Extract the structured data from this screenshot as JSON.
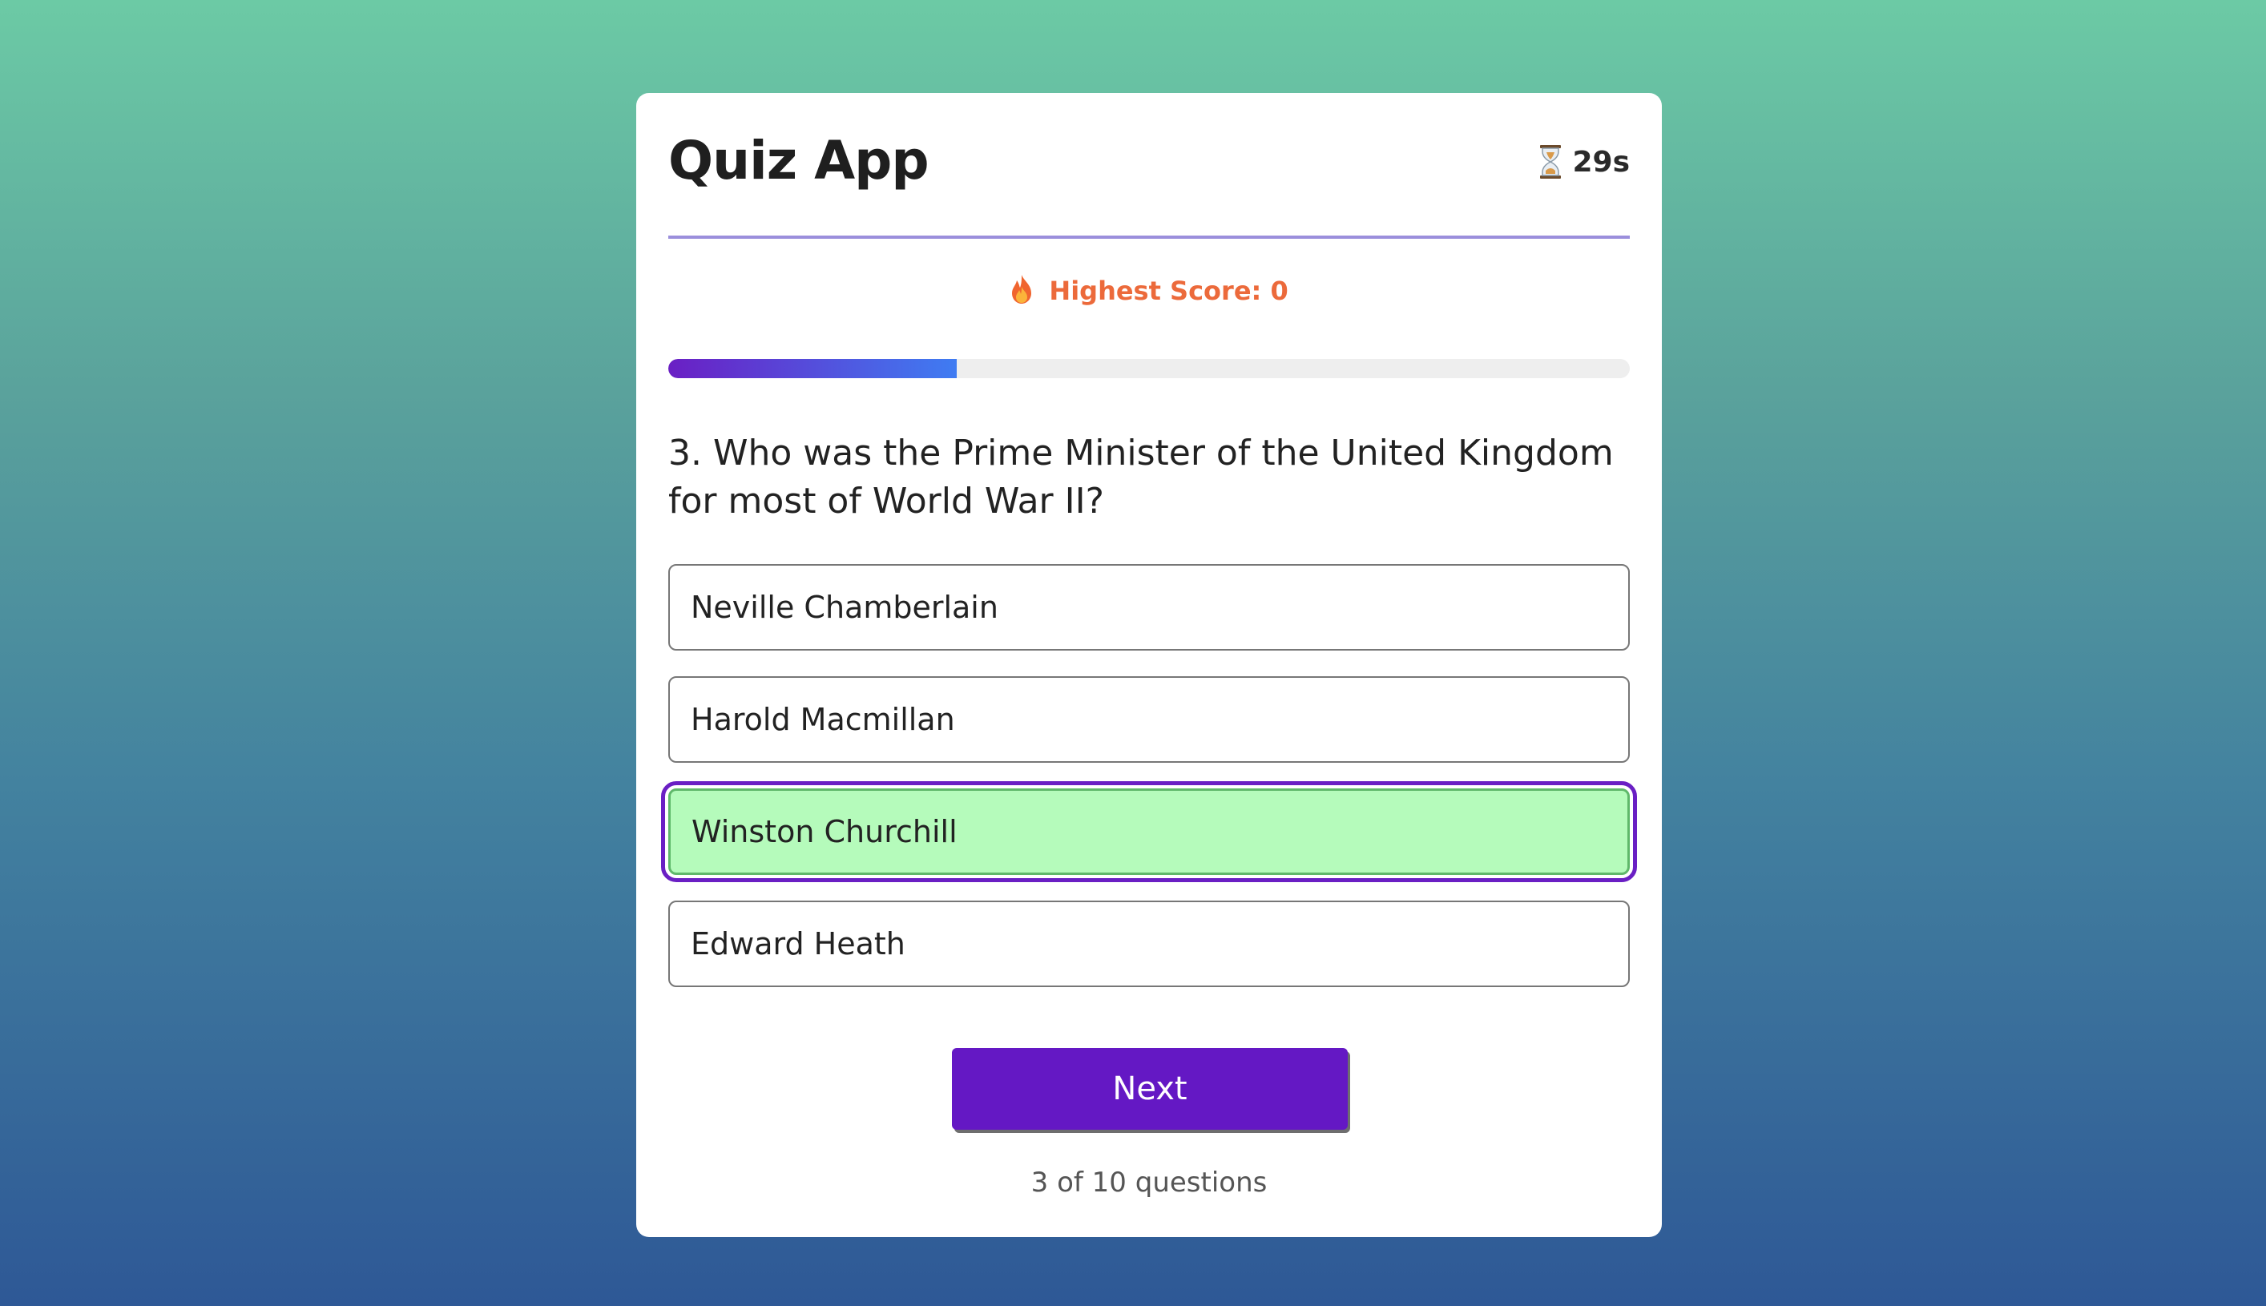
{
  "app": {
    "title": "Quiz App",
    "timer": "29s",
    "timer_icon": "hourglass-icon"
  },
  "score": {
    "text": "Highest Score: 0",
    "icon": "fire-icon",
    "color": "#ec6a3b"
  },
  "progress": {
    "fraction": 0.3
  },
  "question": {
    "text": "3. Who was the Prime Minister of the United Kingdom for most of World War II?"
  },
  "options": [
    {
      "label": "Neville Chamberlain",
      "selected": false
    },
    {
      "label": "Harold Macmillan",
      "selected": false
    },
    {
      "label": "Winston Churchill",
      "selected": true
    },
    {
      "label": "Edward Heath",
      "selected": false
    }
  ],
  "actions": {
    "next_label": "Next"
  },
  "footer": {
    "count_text": "3 of 10 questions"
  },
  "colors": {
    "accent": "#6418c4",
    "selected_bg": "#b5fbbb",
    "selected_border": "#5fb86a"
  }
}
